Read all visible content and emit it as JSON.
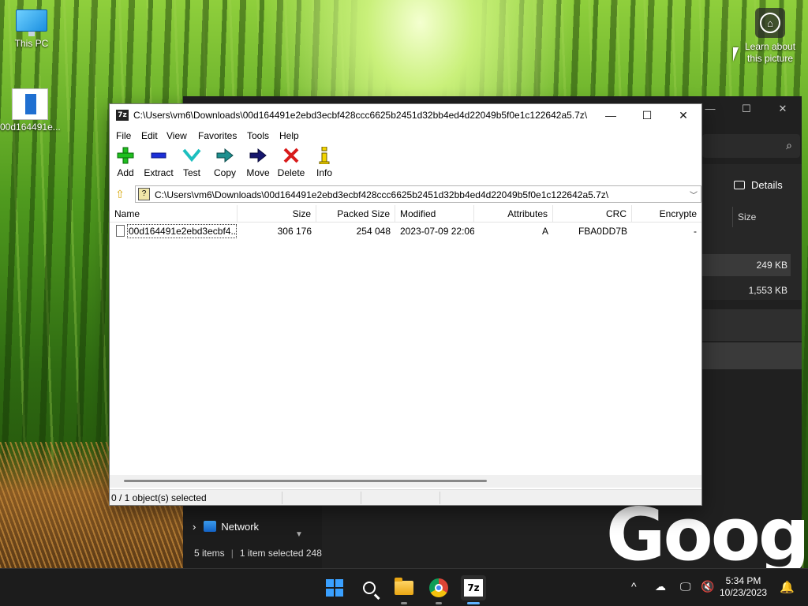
{
  "desktop": {
    "icons": [
      {
        "label": "This PC"
      },
      {
        "label": "00d164491e..."
      }
    ],
    "learn_about": "Learn about this picture",
    "google_text": "Google"
  },
  "explorer": {
    "minimize": "—",
    "maximize": "☐",
    "close": "✕",
    "details_label": "Details",
    "size_header": "Size",
    "sizes": [
      "249 KB",
      "1,553 KB"
    ],
    "network_label": "Network",
    "status_items": "5 items",
    "status_selected": "1 item selected",
    "status_size": "248"
  },
  "sevenzip": {
    "title": "C:\\Users\\vm6\\Downloads\\00d164491e2ebd3ecbf428ccc6625b2451d32bb4ed4d22049b5f0e1c122642a5.7z\\",
    "app_icon_text": "7z",
    "window_buttons": {
      "minimize": "—",
      "maximize": "☐",
      "close": "✕"
    },
    "menu": [
      "File",
      "Edit",
      "View",
      "Favorites",
      "Tools",
      "Help"
    ],
    "toolbar": [
      {
        "label": "Add",
        "icon": "plus-icon"
      },
      {
        "label": "Extract",
        "icon": "minus-icon"
      },
      {
        "label": "Test",
        "icon": "check-icon"
      },
      {
        "label": "Copy",
        "icon": "copy-arrow-icon"
      },
      {
        "label": "Move",
        "icon": "move-arrow-icon"
      },
      {
        "label": "Delete",
        "icon": "x-icon"
      },
      {
        "label": "Info",
        "icon": "info-icon"
      }
    ],
    "address": "C:\\Users\\vm6\\Downloads\\00d164491e2ebd3ecbf428ccc6625b2451d32bb4ed4d22049b5f0e1c122642a5.7z\\",
    "columns": [
      "Name",
      "Size",
      "Packed Size",
      "Modified",
      "Attributes",
      "CRC",
      "Encrypte"
    ],
    "rows": [
      {
        "name": "00d164491e2ebd3ecbf4...",
        "size": "306 176",
        "packed": "254 048",
        "modified": "2023-07-09 22:06",
        "attributes": "A",
        "crc": "FBA0DD7B",
        "encrypted": "-"
      }
    ],
    "status": "0 / 1 object(s) selected"
  },
  "taskbar": {
    "time": "5:34 PM",
    "date": "10/23/2023",
    "tray_chevron": "^"
  },
  "colors": {
    "accent": "#3aa0ff",
    "taskbar_bg": "#1c1c1c",
    "explorer_bg": "#202020"
  }
}
